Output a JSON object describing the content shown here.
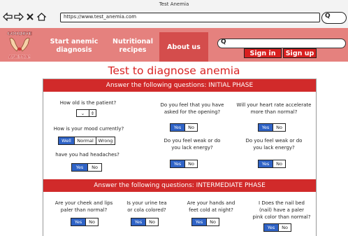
{
  "browser": {
    "window_title": "Test Anemia",
    "url": "https://www.test_anemia.com",
    "search_glyph": "Q"
  },
  "header": {
    "logo_text_top": "GOODBYE",
    "logo_text_bottom": "ANEMIA!",
    "nav": {
      "start_line1": "Start anemic",
      "start_line2": "diagnosis",
      "recipes_line1": "Nutritional",
      "recipes_line2": "recipes",
      "about": "About us"
    },
    "search_glyph": "Q",
    "sign_in": "Sign in",
    "sign_up": "Sign up"
  },
  "main": {
    "title": "Test to diagnose anemia",
    "initial_phase": {
      "banner": "Answer the following questions: INITIAL PHASE",
      "q_age": "How old is the patient?",
      "q_mood": "How is your mood currently?",
      "mood_options": [
        "Well",
        "Normal",
        "Wrong"
      ],
      "q_headaches": "have you had headaches?",
      "q_feel_line1": "Do you feel that you have",
      "q_feel_line2": "asked for the opening?",
      "q_heart_line1": "Will your heart rate accelerate",
      "q_heart_line2": "more than normal?",
      "q_weak_line1": "Do you feel weak or do",
      "q_weak_line2": "you lack energy?"
    },
    "intermediate_phase": {
      "banner": "Answer the following questions: INTERMEDIATE PHASE",
      "q_cheek_line1": "Are your cheek and lips",
      "q_cheek_line2": "paler than normal?",
      "q_urine_line1": "Is your urine tea",
      "q_urine_line2": "or cola colored?",
      "q_hands_line1": "Are your hands and",
      "q_hands_line2": "feet cold at night?",
      "q_nail_line1": "I Does the nail bed",
      "q_nail_line2": "(nail) have a paler",
      "q_nail_line3": "pink color than normal?"
    },
    "yes": "Yes",
    "no": "No"
  },
  "colors": {
    "header_bg": "#e5817e",
    "nav_active": "#d44d4c",
    "banner_red": "#d12a2a",
    "title_red": "#d92424",
    "button_blue": "#2f63c6",
    "auth_red": "#d81f1f"
  }
}
